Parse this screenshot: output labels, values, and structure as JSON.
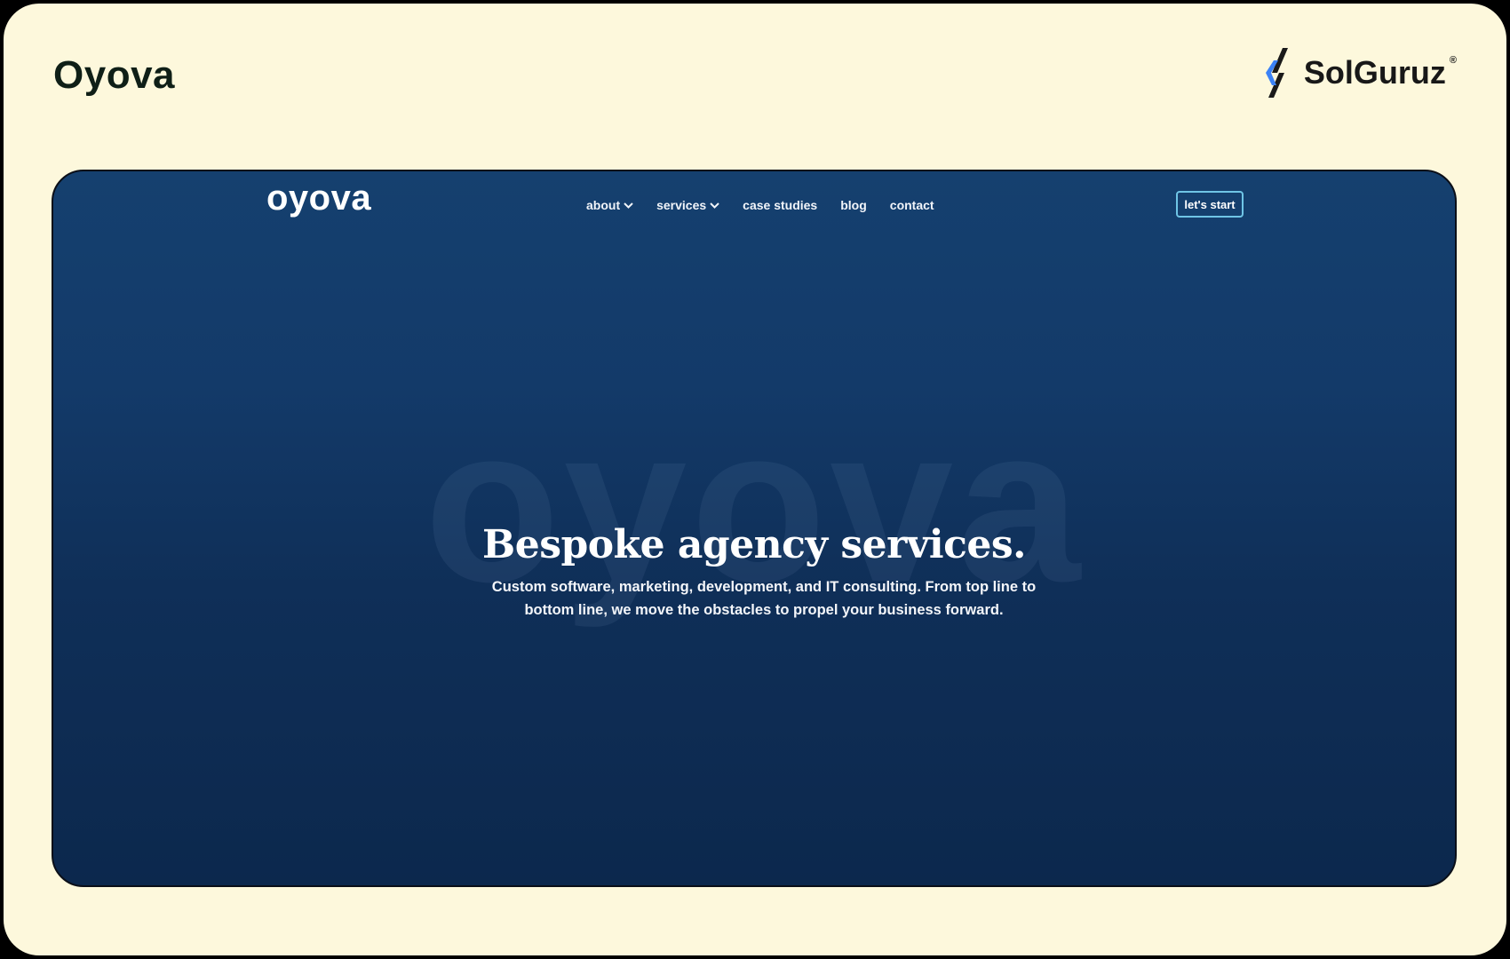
{
  "outer": {
    "title": "Oyova",
    "brand_name": "SolGuruz",
    "brand_reg": "®",
    "brand_icon": "solguruz-logo-icon"
  },
  "site": {
    "logo": "oyova",
    "nav": [
      {
        "label": "about",
        "has_dropdown": true
      },
      {
        "label": "services",
        "has_dropdown": true
      },
      {
        "label": "case studies",
        "has_dropdown": false
      },
      {
        "label": "blog",
        "has_dropdown": false
      },
      {
        "label": "contact",
        "has_dropdown": false
      }
    ],
    "cta_label": "let's start",
    "hero": {
      "watermark": "oyova",
      "headline": "Bespoke agency services.",
      "subtext": "Custom software, marketing, development, and IT consulting. From top line to bottom line, we move the obstacles to propel your business forward."
    }
  },
  "colors": {
    "page_background": "#fdf8dc",
    "hero_gradient_top": "#15406f",
    "hero_gradient_bottom": "#0c284d",
    "cta_border": "#6fc5e6"
  }
}
